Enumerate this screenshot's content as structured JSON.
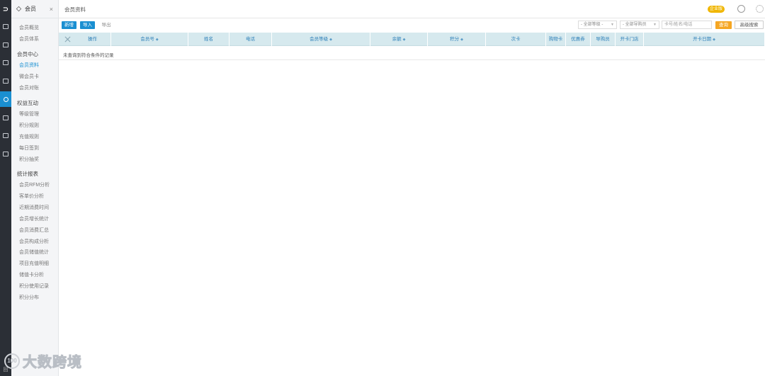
{
  "rail": {
    "logo": "⊃",
    "bottom_label": "回"
  },
  "submenu": {
    "title": "会员",
    "close": "×",
    "items_top": [
      "会员概览",
      "会员体系"
    ],
    "groups": [
      {
        "title": "会员中心",
        "items": [
          "会员资料",
          "微会员卡",
          "会员对账"
        ]
      },
      {
        "title": "权益互动",
        "items": [
          "等级管理",
          "积分规则",
          "充值规则",
          "每日签到",
          "积分抽奖"
        ]
      },
      {
        "title": "统计报表",
        "items": [
          "会员RFM分析",
          "客单价分析",
          "近期消费时间",
          "会员增长统计",
          "会员消费汇总",
          "会员构成分析",
          "会员储值统计",
          "项目充值明细",
          "储值卡分析",
          "积分使用记录",
          "积分分布"
        ]
      }
    ],
    "active_item": "会员资料"
  },
  "topbar": {
    "breadcrumb": "会员资料",
    "edition": "企业版"
  },
  "toolbar": {
    "add": "新增",
    "import": "导入",
    "export": "导出",
    "level_select": "- 全部等级 -",
    "guide_select": "- 全部导购员",
    "search_placeholder": "卡号/姓名/电话",
    "search_button": "查询",
    "advanced": "高级搜索"
  },
  "table": {
    "columns": [
      {
        "label": "操作",
        "sortable": false
      },
      {
        "label": "会员号",
        "sortable": true
      },
      {
        "label": "姓名",
        "sortable": false
      },
      {
        "label": "电话",
        "sortable": false
      },
      {
        "label": "会员等级",
        "sortable": true
      },
      {
        "label": "余额",
        "sortable": true
      },
      {
        "label": "积分",
        "sortable": true
      },
      {
        "label": "次卡",
        "sortable": false
      },
      {
        "label": "购物卡",
        "sortable": false
      },
      {
        "label": "优惠券",
        "sortable": false
      },
      {
        "label": "导购员",
        "sortable": false
      },
      {
        "label": "开卡门店",
        "sortable": false
      },
      {
        "label": "开卡日期",
        "sortable": true
      }
    ],
    "sort_glyph": "◆",
    "empty_message": "未查询到符合条件的记录"
  },
  "watermark": {
    "badge": "100",
    "text": "大数跨境"
  },
  "colors": {
    "accent": "#1a8fd1",
    "rail": "#2b2f36",
    "header": "#d6e9ee",
    "orange": "#f5a623",
    "edition": "#f0b600"
  }
}
